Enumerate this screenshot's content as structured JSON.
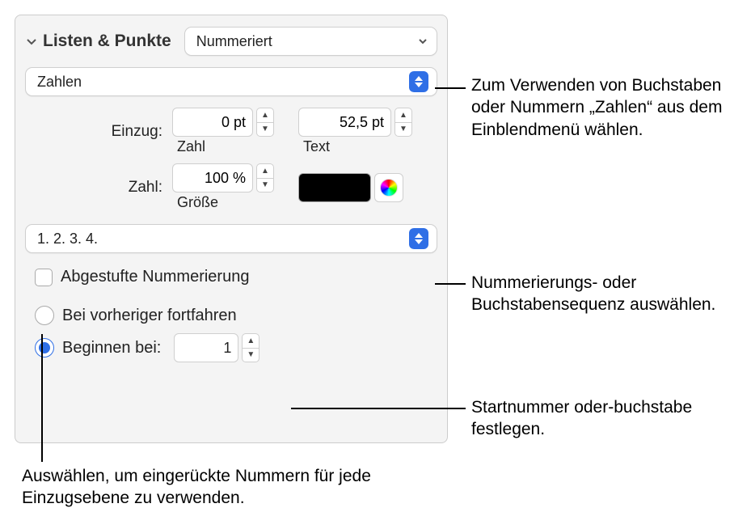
{
  "header": {
    "title": "Listen & Punkte",
    "style_select": "Nummeriert"
  },
  "format_select": "Zahlen",
  "indent": {
    "label": "Einzug:",
    "number_value": "0 pt",
    "number_sublabel": "Zahl",
    "text_value": "52,5 pt",
    "text_sublabel": "Text"
  },
  "size": {
    "label": "Zahl:",
    "value": "100 %",
    "sublabel": "Größe"
  },
  "sequence_select": "1. 2. 3. 4.",
  "tiered_checkbox": "Abgestufte Nummerierung",
  "radio_continue": "Bei vorheriger fortfahren",
  "radio_start": "Beginnen bei:",
  "start_value": "1",
  "callouts": {
    "format": "Zum Verwenden von Buchstaben oder Nummern „Zahlen“ aus dem Einblendmenü wählen.",
    "sequence": "Nummerierungs- oder Buchstabensequenz auswählen.",
    "start": "Startnummer oder-buchstabe festlegen.",
    "tiered": "Auswählen, um eingerückte Nummern für jede Einzugsebene zu verwenden."
  }
}
